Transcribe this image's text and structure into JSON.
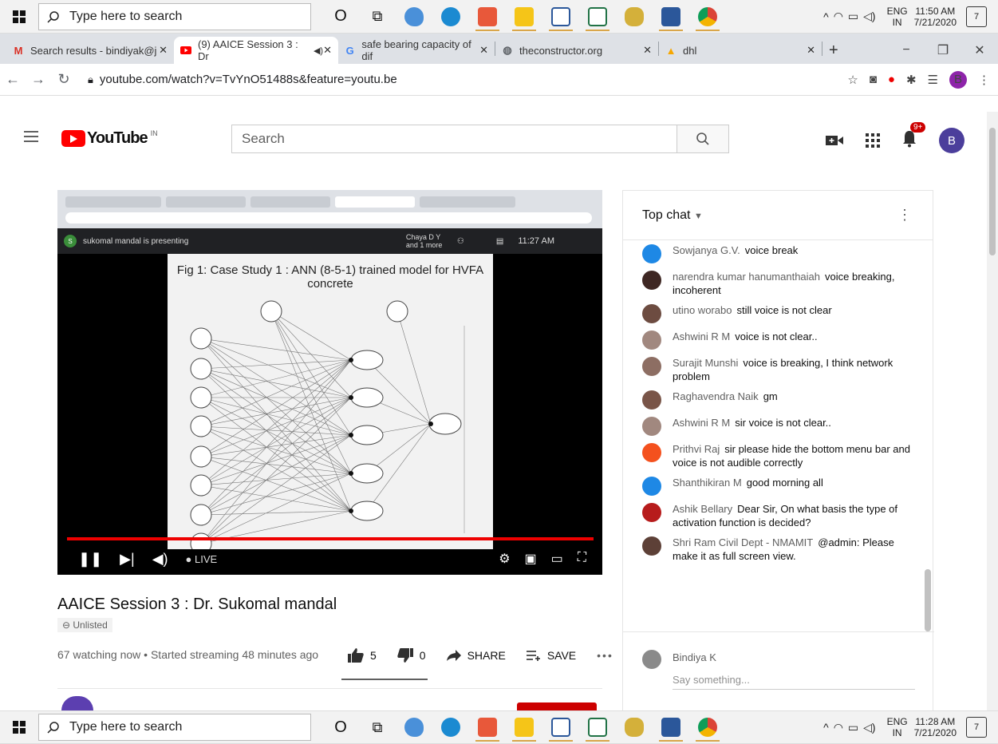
{
  "taskbar": {
    "search_placeholder": "Type here to search",
    "tray": {
      "lang1": "ENG",
      "lang2": "IN"
    },
    "top_clock": {
      "time": "11:50 AM",
      "date": "7/21/2020"
    },
    "bottom_clock": {
      "time": "11:28 AM",
      "date": "7/21/2020"
    },
    "notifications": "7"
  },
  "browser": {
    "tabs": [
      {
        "label": "Search results - bindiyak@j",
        "icon": "gmail-icon"
      },
      {
        "label": "(9) AAICE Session 3 : Dr",
        "icon": "youtube-icon"
      },
      {
        "label": "safe bearing capacity of dif",
        "icon": "google-icon"
      },
      {
        "label": "theconstructor.org",
        "icon": "globe-icon"
      },
      {
        "label": "dhl",
        "icon": "warning-icon"
      }
    ],
    "url": "youtube.com/watch?v=TvYnO51488s&feature=youtu.be",
    "profile_initial": "B"
  },
  "youtube": {
    "logo_text": "YouTube",
    "region": "IN",
    "search_placeholder": "Search",
    "notif_badge": "9+",
    "avatar_initial": "B"
  },
  "video": {
    "presenter_bar": "sukomal mandal is presenting",
    "meet_time": "11:27 AM",
    "participants": "Chaya D Y and 1 more",
    "slide_title_line1": "Fig 1: Case Study 1 : ANN (8-5-1) trained model for HVFA",
    "slide_title_line2": "concrete",
    "live_label": "LIVE",
    "title": "AAICE Session 3 : Dr. Sukomal mandal",
    "unlisted": "Unlisted",
    "stats": "67 watching now • Started streaming 48 minutes ago",
    "likes": "5",
    "dislikes": "0",
    "share": "SHARE",
    "save": "SAVE"
  },
  "chat": {
    "header": "Top chat",
    "messages": [
      {
        "name": "Sowjanya G.V.",
        "text": "voice break",
        "color": "#1e88e5"
      },
      {
        "name": "narendra kumar hanumanthaiah",
        "text": "voice breaking, incoherent",
        "color": "#3e2723"
      },
      {
        "name": "utino worabo",
        "text": "still voice is not clear",
        "color": "#6d4c41"
      },
      {
        "name": "Ashwini R M",
        "text": "voice is not clear..",
        "color": "#a1887f"
      },
      {
        "name": "Surajit Munshi",
        "text": "voice is breaking, I think network problem",
        "color": "#8d6e63"
      },
      {
        "name": "Raghavendra Naik",
        "text": "gm",
        "color": "#795548"
      },
      {
        "name": "Ashwini R M",
        "text": "sir voice is not clear..",
        "color": "#a1887f"
      },
      {
        "name": "Prithvi Raj",
        "text": "sir please hide the bottom menu bar and voice is not audible correctly",
        "color": "#f4511e"
      },
      {
        "name": "Shanthikiran M",
        "text": "good morning all",
        "color": "#1e88e5"
      },
      {
        "name": "Ashik Bellary",
        "text": "Dear Sir, On what basis the type of activation function is decided?",
        "color": "#b71c1c"
      },
      {
        "name": "Shri Ram Civil Dept - NMAMIT",
        "text": "@admin: Please make it as full screen view.",
        "color": "#5d4037"
      }
    ],
    "user_name": "Bindiya K",
    "input_placeholder": "Say something..."
  }
}
